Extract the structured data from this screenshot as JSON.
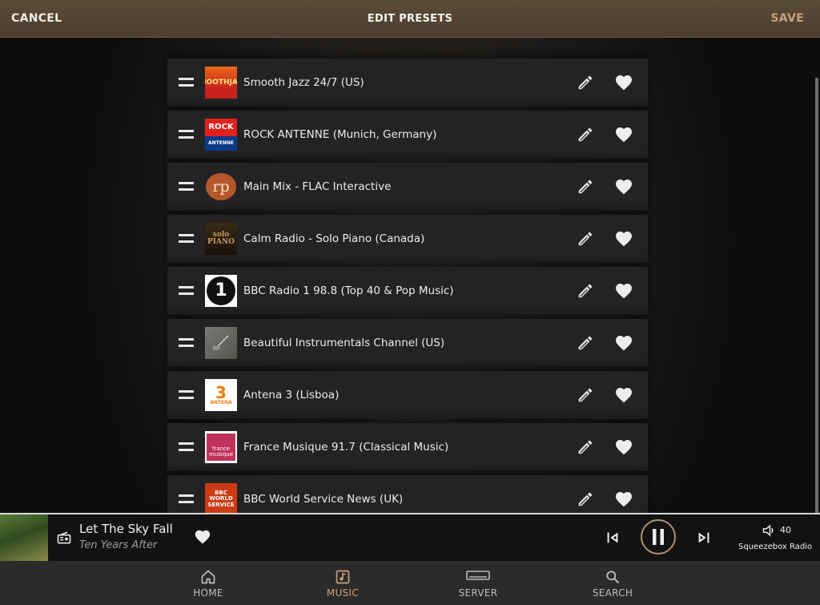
{
  "header": {
    "cancel_label": "CANCEL",
    "title": "EDIT PRESETS",
    "save_label": "SAVE"
  },
  "presets": [
    {
      "label": "Smooth Jazz 24/7 (US)",
      "thumb_text": "SMOOTHJAZZ"
    },
    {
      "label": "ROCK ANTENNE (Munich, Germany)",
      "thumb_text": "ROCK",
      "thumb_sub": "ANTENNE"
    },
    {
      "label": "Main Mix - FLAC Interactive",
      "thumb_text": "rp"
    },
    {
      "label": "Calm Radio - Solo Piano (Canada)",
      "thumb_text": "solo PIANO"
    },
    {
      "label": "BBC Radio 1 98.8 (Top 40 & Pop Music)",
      "thumb_text": "1"
    },
    {
      "label": "Beautiful Instrumentals Channel (US)",
      "thumb_text": ""
    },
    {
      "label": "Antena 3 (Lisboa)",
      "thumb_text": "3",
      "thumb_sub": "ANTENA"
    },
    {
      "label": "France Musique 91.7 (Classical Music)",
      "thumb_text": "france musique"
    },
    {
      "label": "BBC World Service News (UK)",
      "thumb_text": "BBC WORLD SERVICE"
    }
  ],
  "now_playing": {
    "title": "Let The Sky Fall",
    "artist": "Ten Years After",
    "volume": "40",
    "player_name": "Squeezebox Radio"
  },
  "nav": {
    "items": [
      {
        "label": "HOME",
        "icon": "home-icon"
      },
      {
        "label": "MUSIC",
        "icon": "music-icon"
      },
      {
        "label": "SERVER",
        "icon": "server-icon"
      },
      {
        "label": "SEARCH",
        "icon": "search-icon"
      }
    ],
    "active": "MUSIC"
  },
  "colors": {
    "accent": "#c9a27a",
    "header_bg": "#4d3e2e",
    "row_bg": "#232323",
    "nav_bg": "#2b2b2b"
  }
}
